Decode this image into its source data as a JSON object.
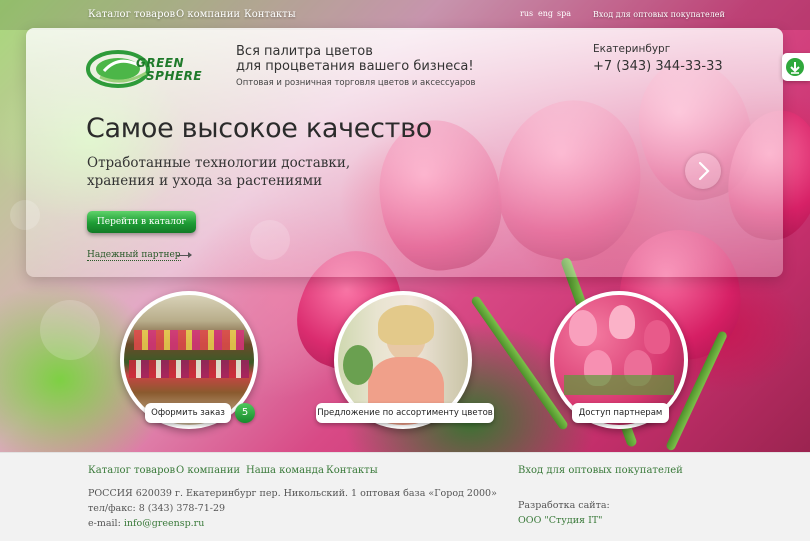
{
  "topnav": {
    "items": [
      "Каталог товаров",
      "О компании",
      "Контакты"
    ],
    "langs": [
      "rus",
      "eng",
      "spa"
    ],
    "wholesale_login": "Вход для оптовых покупателей"
  },
  "header": {
    "logo_line1": "GREEN",
    "logo_line2": "SPHERE",
    "tagline_line1": "Вся палитра цветов",
    "tagline_line2": "для процветания вашего бизнеса!",
    "subtagline": "Оптовая и розничная торговля цветов и аксессуаров",
    "city": "Екатеринбург",
    "phone": "+7 (343) 344-33-33"
  },
  "slide": {
    "headline": "Самое высокое качество",
    "subhead_line1": "Отработанные технологии доставки,",
    "subhead_line2": "хранения и ухода за растениями",
    "button_label": "Перейти в каталог",
    "partner_link": "Надежный партнер"
  },
  "promos": [
    {
      "label": "Оформить заказ",
      "badge": "5"
    },
    {
      "label": "Предложение по ассортименту цветов"
    },
    {
      "label": "Доступ партнерам"
    }
  ],
  "footer": {
    "nav": [
      "Каталог товаров",
      "О компании",
      "Наша команда",
      "Контакты"
    ],
    "wholesale_login": "Вход для оптовых покупателей",
    "address": "РОССИЯ 620039 г. Екатеринбург пер. Никольский. 1 оптовая база «Город 2000»",
    "phone_fax": "тел/факс: 8 (343) 378-71-29",
    "email_label": "e-mail:",
    "email": "info@greensp.ru",
    "dev_label": "Разработка сайта:",
    "dev_name": "ООО \"Студия IT\""
  },
  "colors": {
    "accent_green": "#1e9c35",
    "link_green": "#3a7a3a",
    "tulip_pink": "#d91f66"
  }
}
